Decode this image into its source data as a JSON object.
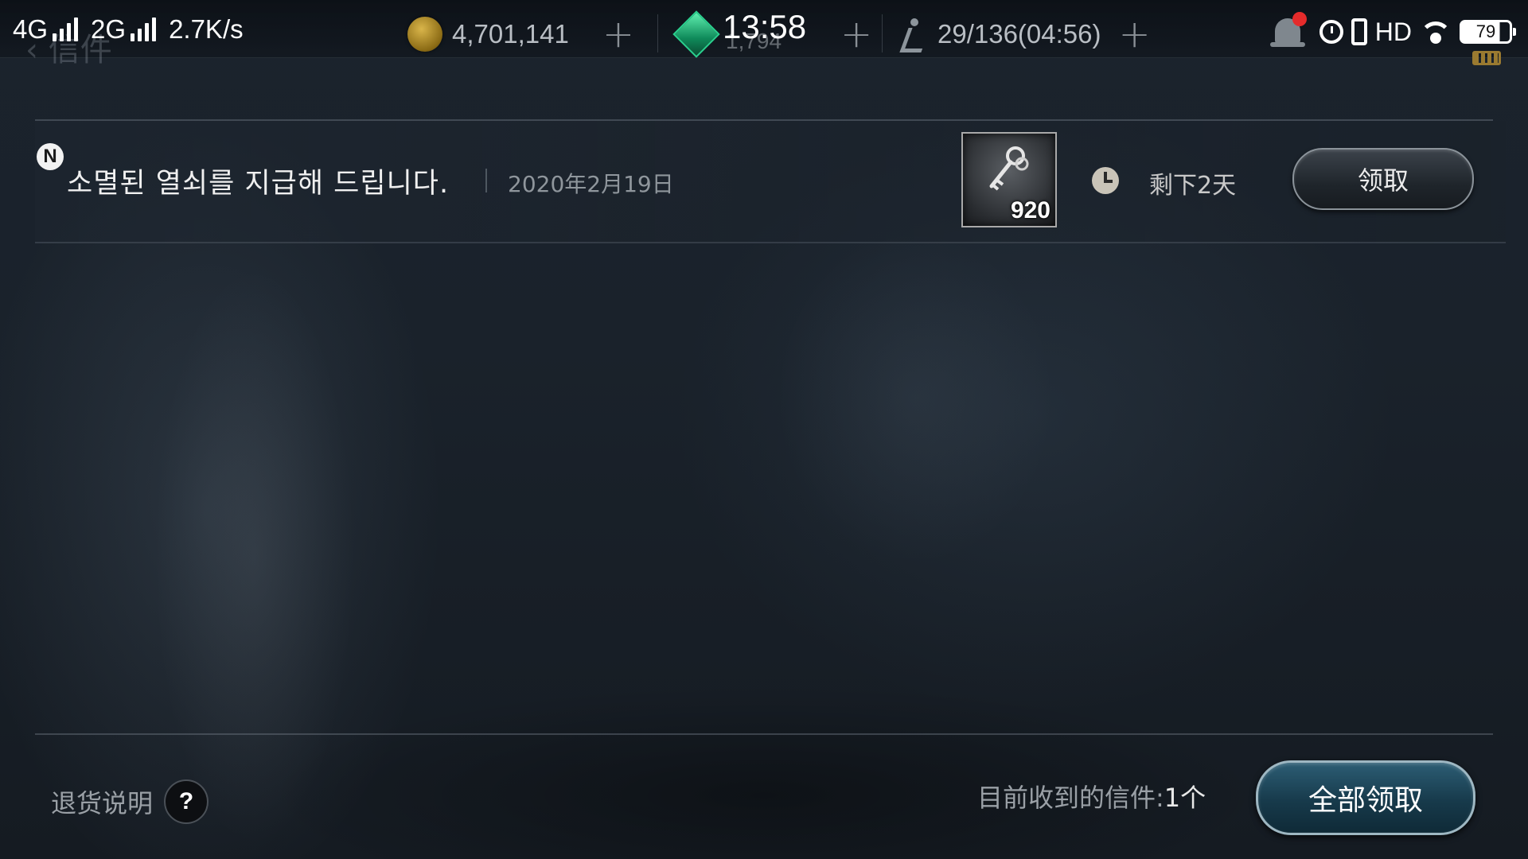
{
  "status_bar": {
    "network_1": "4G",
    "network_2": "2G",
    "speed": "2.7K/s",
    "time": "13:58",
    "battery": "79",
    "hd_label": "HD"
  },
  "game_header": {
    "back_label": "信件",
    "gold": "4,701,141",
    "gems": "1,794",
    "stamina": "29/136(04:56)",
    "icons": [
      "gold-coin-icon",
      "emerald-gem-icon",
      "stamina-icon",
      "bell-icon",
      "chat-icon",
      "gear-icon",
      "home-icon"
    ]
  },
  "mail_list": [
    {
      "badge": "N",
      "title": "소멸된 열쇠를 지급해 드립니다.",
      "date": "2020年2月19日",
      "item_icon": "key-icon",
      "item_count": "920",
      "time_left": "剩下2天",
      "claim_label": "领取"
    }
  ],
  "footer": {
    "return_info_label": "退货说明",
    "help_symbol": "?",
    "mail_count_label": "目前收到的信件:",
    "mail_count_value": "1个",
    "claim_all_label": "全部领取"
  },
  "colors": {
    "claim_all_button": "#1d4a5e",
    "notification_dot": "#e52b2b",
    "gem": "#1fb57a",
    "coin": "#c9a23a"
  }
}
